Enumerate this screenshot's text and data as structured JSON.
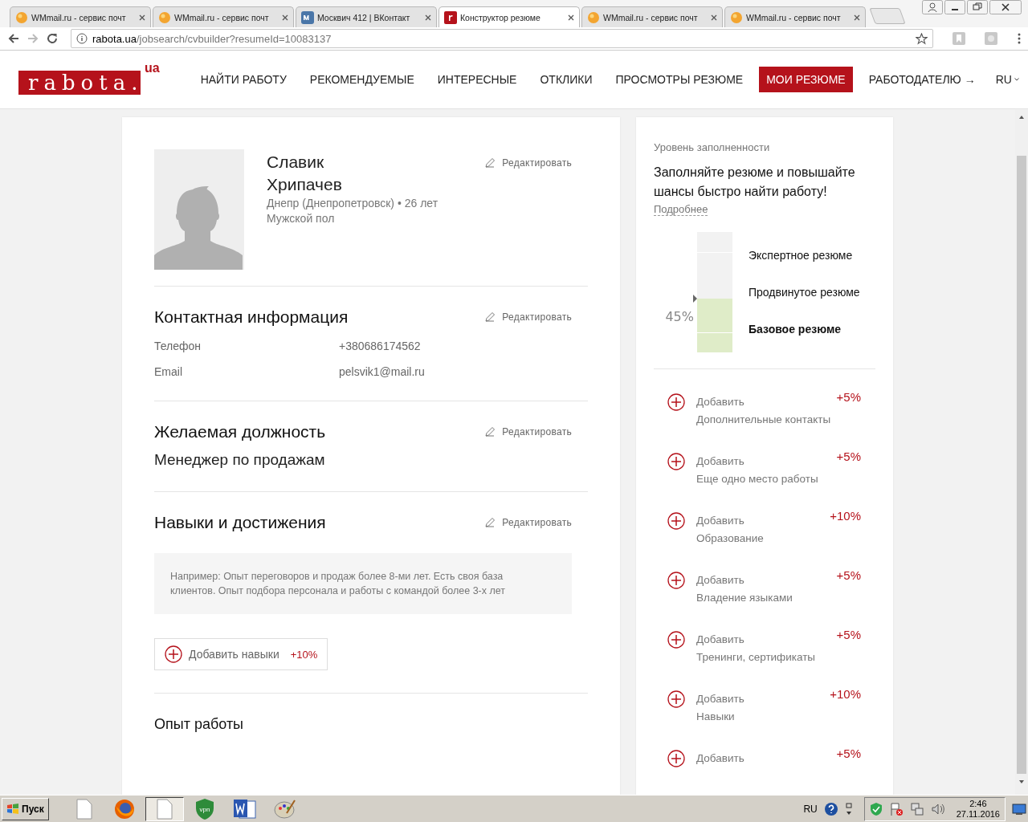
{
  "browser": {
    "tabs": [
      {
        "kind": "mail",
        "title": "WMmail.ru - сервис почт",
        "selected": false
      },
      {
        "kind": "mail",
        "title": "WMmail.ru - сервис почт",
        "selected": false
      },
      {
        "kind": "vk",
        "title": "Москвич 412 | ВКонтакт",
        "selected": false
      },
      {
        "kind": "site",
        "title": "Конструктор резюме",
        "selected": true
      },
      {
        "kind": "mail",
        "title": "WMmail.ru - сервис почт",
        "selected": false
      },
      {
        "kind": "mail",
        "title": "WMmail.ru - сервис почт",
        "selected": false
      }
    ],
    "url_host": "rabota.ua",
    "url_path": "/jobsearch/cvbuilder?resumeId=10083137"
  },
  "site": {
    "logo": "rabota.",
    "logo_suffix": "ua",
    "nav": [
      {
        "label": "НАЙТИ РАБОТУ",
        "selected": false
      },
      {
        "label": "РЕКОМЕНДУЕМЫЕ",
        "selected": false
      },
      {
        "label": "ИНТЕРЕСНЫЕ",
        "selected": false
      },
      {
        "label": "ОТКЛИКИ",
        "selected": false
      },
      {
        "label": "ПРОСМОТРЫ РЕЗЮМЕ",
        "selected": false
      },
      {
        "label": "МОИ РЕЗЮМЕ",
        "selected": true
      },
      {
        "label": "РАБОТОДАТЕЛЮ →",
        "selected": false
      }
    ],
    "language": "RU"
  },
  "profile": {
    "first_name": "Славик",
    "last_name": "Хрипачев",
    "location": "Днепр (Днепропетровск) • 26 лет",
    "gender": "Мужской пол",
    "edit": "Редактировать"
  },
  "sections": [
    {
      "kind": "contacts",
      "title": "Контактная информация",
      "edit": "Редактировать",
      "fields": [
        {
          "label": "Телефон",
          "value": "+380686174562"
        },
        {
          "label": "Email",
          "value": "pelsvik1@mail.ru"
        }
      ]
    },
    {
      "kind": "position",
      "title": "Желаемая должность",
      "edit": "Редактировать",
      "value": "Менеджер по продажам"
    },
    {
      "kind": "skills",
      "title": "Навыки и достижения",
      "edit": "Редактировать",
      "hint": "Например: Опыт переговоров и продаж более 8-ми лет. Есть своя база клиентов. Опыт подбора персонала и работы с командой более 3-х лет",
      "button": "Добавить навыки",
      "bonus": "+10%"
    },
    {
      "kind": "heading",
      "title": "Опыт работы"
    }
  ],
  "completeness": {
    "caption": "Уровень заполненности",
    "headline": "Заполняйте резюме и повышайте шансы быстро найти работу!",
    "more": "Подробнее",
    "level": 0.45,
    "reading": "45%",
    "tiers": [
      {
        "label": "Экспертное резюме",
        "selected": false
      },
      {
        "label": "Продвинутое резюме",
        "selected": false
      },
      {
        "label": "Базовое резюме",
        "selected": true
      }
    ],
    "suggestions": [
      {
        "action": "Добавить",
        "label": "Дополнительные контакты",
        "bonus": "+5%"
      },
      {
        "action": "Добавить",
        "label": "Еще одно место работы",
        "bonus": "+5%"
      },
      {
        "action": "Добавить",
        "label": "Образование",
        "bonus": "+10%"
      },
      {
        "action": "Добавить",
        "label": "Владение языками",
        "bonus": "+5%"
      },
      {
        "action": "Добавить",
        "label": "Тренинги, сертификаты",
        "bonus": "+5%"
      },
      {
        "action": "Добавить",
        "label": "Навыки",
        "bonus": "+10%"
      },
      {
        "action": "Добавить",
        "bonus": "+5%"
      }
    ]
  },
  "taskbar": {
    "start": "Пуск",
    "apps": [
      {
        "kind": "document",
        "selected": false
      },
      {
        "kind": "firefox",
        "selected": false
      },
      {
        "kind": "document",
        "selected": true
      },
      {
        "kind": "vpn",
        "selected": false
      },
      {
        "kind": "word",
        "selected": false
      },
      {
        "kind": "paint",
        "selected": false
      }
    ],
    "language": "RU",
    "time": "2:46",
    "date": "27.11.2016"
  }
}
